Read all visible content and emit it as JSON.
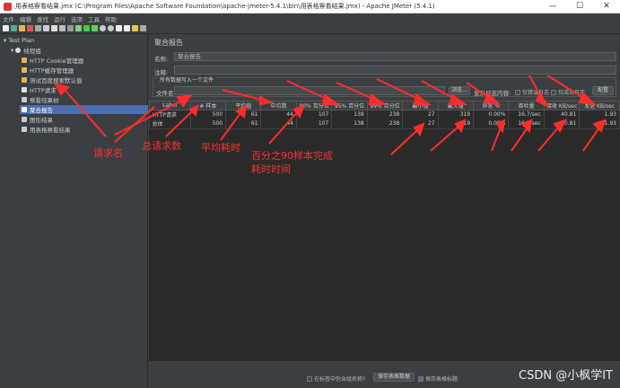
{
  "window": {
    "title": "用表格察看结果.jmx (C:\\Program Files\\Apache Software Foundation\\apache-jmeter-5.4.1\\bin\\用表格察看结果.jmx) - Apache JMeter (5.4.1)",
    "minimize": "—",
    "maximize": "☐",
    "close": "✕"
  },
  "menu": [
    "文件",
    "编辑",
    "查找",
    "运行",
    "选项",
    "工具",
    "帮助"
  ],
  "tree": {
    "root": "Test Plan",
    "thread_group": "线程组",
    "items": [
      "HTTP Cookie管理器",
      "HTTP缓存管理器",
      "测试百度搜索默认值",
      "HTTP请求",
      "察看结果树",
      "聚合报告",
      "图形结果",
      "用表格察看结果"
    ],
    "selected": "聚合报告"
  },
  "panel": {
    "title": "聚合报告",
    "name_label": "名称:",
    "name_value": "聚合报告",
    "comment_label": "注释:",
    "comment_value": "",
    "group_title": "所有数据写入一个文件",
    "file_label": "文件名",
    "browse_button": "浏览...",
    "log_label": "显示日志内容:",
    "errors_only": "仅错误日志",
    "success_only": "仅成功日志",
    "config_button": "配置"
  },
  "table": {
    "headers": [
      "Label",
      "# 样本",
      "平均值",
      "中位数",
      "90% 百分位",
      "95% 百分位",
      "99% 百分位",
      "最小值",
      "最大值",
      "异常 %",
      "吞吐量",
      "接收 KB/sec",
      "发送 KB/sec"
    ],
    "rows": [
      [
        "HTTP请求",
        "500",
        "61",
        "44",
        "107",
        "138",
        "238",
        "27",
        "319",
        "0.00%",
        "16.7/sec",
        "40.81",
        "1.93"
      ],
      [
        "总体",
        "500",
        "61",
        "44",
        "107",
        "138",
        "238",
        "27",
        "319",
        "0.00%",
        "16.7/sec",
        "40.81",
        "1.93"
      ]
    ]
  },
  "footer": {
    "include_group": "在标签中包含组名称?",
    "save_button": "保存表格数据",
    "save_header": "保存表格标题"
  },
  "annotations": {
    "label_name": "请求名",
    "sample_total": "总请求数",
    "avg_time": "平均耗时",
    "p90": "百分之90样本完成",
    "p90_b": "耗时时间"
  },
  "watermark": "CSDN @小枫学IT",
  "colors": {
    "annotation": "#ff2d2d",
    "selection": "#4b6eaf",
    "background": "#3c3f41"
  }
}
